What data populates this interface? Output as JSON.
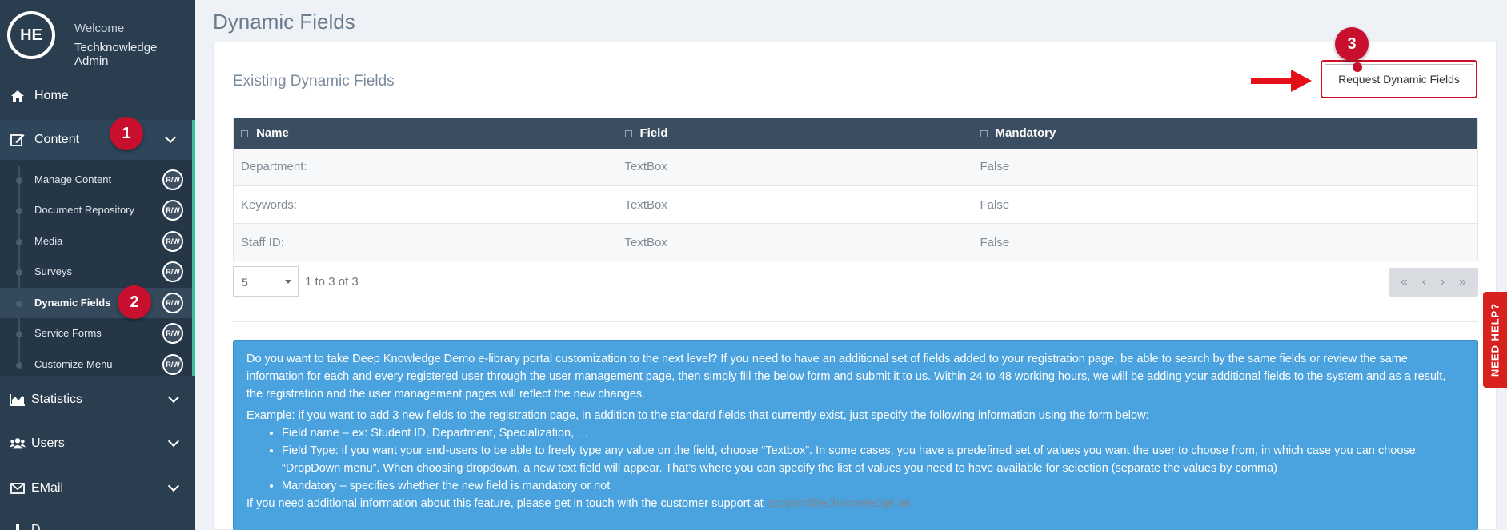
{
  "profile": {
    "initials": "HE",
    "welcome": "Welcome",
    "name": "Techknowledge Admin"
  },
  "nav": {
    "home": "Home",
    "content": "Content",
    "statistics": "Statistics",
    "users": "Users",
    "email": "EMail",
    "cut": "D..."
  },
  "content_items": [
    {
      "label": "Manage Content",
      "rw": "R/W"
    },
    {
      "label": "Document Repository",
      "rw": "R/W"
    },
    {
      "label": "Media",
      "rw": "R/W"
    },
    {
      "label": "Surveys",
      "rw": "R/W"
    },
    {
      "label": "Dynamic Fields",
      "rw": "R/W"
    },
    {
      "label": "Service Forms",
      "rw": "R/W"
    },
    {
      "label": "Customize Menu",
      "rw": "R/W"
    }
  ],
  "badges": {
    "b1": "1",
    "b2": "2",
    "b3": "3"
  },
  "page": {
    "title": "Dynamic Fields",
    "panel_title": "Existing Dynamic Fields",
    "request_button": "Request Dynamic Fields"
  },
  "table": {
    "headers": [
      "Name",
      "Field",
      "Mandatory"
    ],
    "rows": [
      [
        "Department:",
        "TextBox",
        "False"
      ],
      [
        "Keywords:",
        "TextBox",
        "False"
      ],
      [
        "Staff ID:",
        "TextBox",
        "False"
      ]
    ]
  },
  "pager": {
    "page_size": "5",
    "info": "1 to 3 of 3",
    "first": "«",
    "prev": "‹",
    "next": "›",
    "last": "»"
  },
  "info_box": {
    "intro": "Do you want to take Deep Knowledge Demo e-library portal customization to the next level? If you need to have an additional set of fields added to your registration page, be able to search by the same fields or review the same information for each and every registered user through the user management page, then simply fill the below form and submit it to us. Within 24 to 48 working hours, we will be adding your additional fields to the system and as a result, the registration and the user management pages will reflect the new changes.",
    "example": "Example: if you want to add 3 new fields to the registration page, in addition to the standard fields that currently exist, just specify the following information using the form below:",
    "bullets": [
      "Field name – ex: Student ID, Department, Specialization, …",
      "Field Type: if you want your end-users to be able to freely type any value on the field, choose “Textbox”. In some cases, you have a predefined set of values you want the user to choose from, in which case you can choose “DropDown menu”. When choosing dropdown, a new text field will appear. That’s where you can specify the list of values you need to have available for selection (separate the values by comma)",
      "Mandatory – specifies whether the new field is mandatory or not"
    ],
    "contact_prefix": "If you need additional information about this feature, please get in touch with the customer support at ",
    "contact_email": "support@techknowledge.ae"
  },
  "need_help": "NEED HELP?",
  "colors": {
    "sidebar": "#2b3e50",
    "accent": "#3bbfa0",
    "badge": "#c8102e",
    "info": "#4aa3df"
  }
}
